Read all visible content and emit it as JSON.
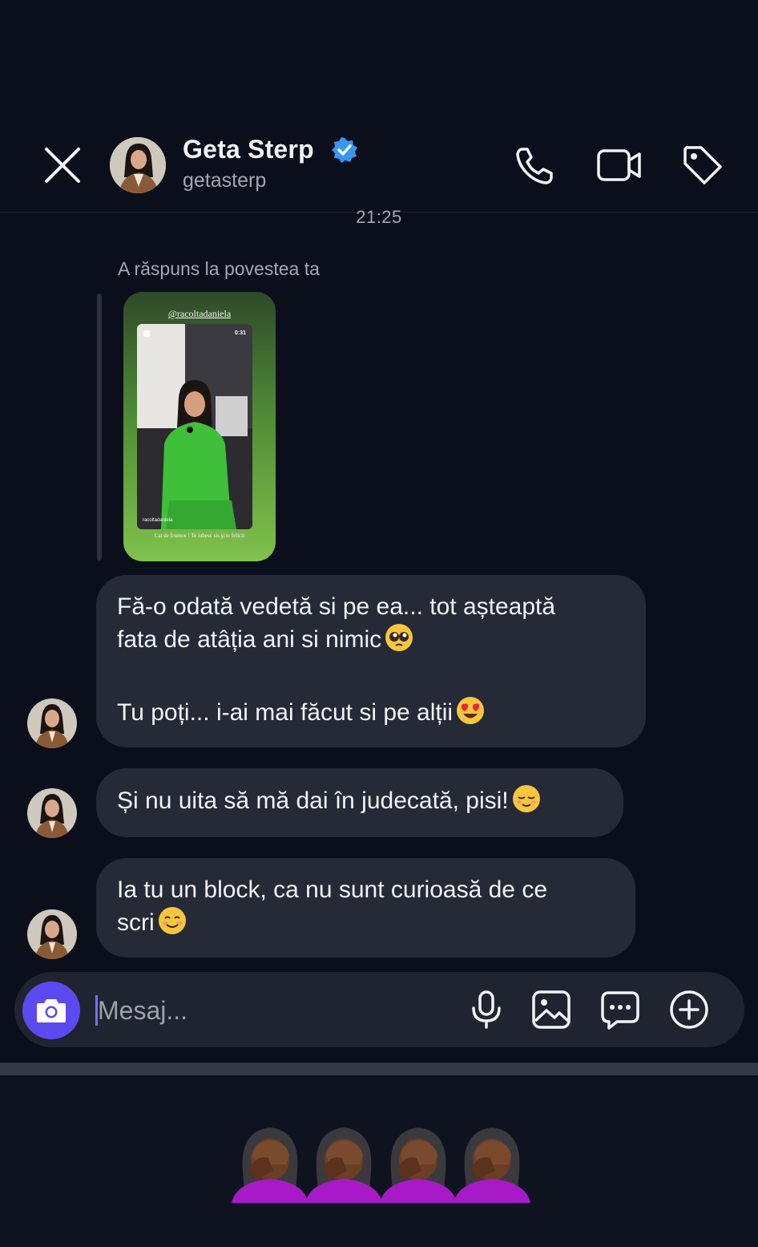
{
  "status": {
    "partial_text": ""
  },
  "header": {
    "name": "Geta Sterp",
    "handle": "getasterp",
    "verified_color": "#3897f0",
    "icons": [
      "close-icon",
      "phone-icon",
      "video-icon",
      "tag-icon"
    ]
  },
  "chat": {
    "timestamp": "21:25",
    "reply_note": "A răspuns la povestea ta",
    "story": {
      "handle": "@racoltadaniela",
      "duration": "0:31",
      "username": "racoltadaniela",
      "caption": "Cat de frumos ! Te iubesc sis și te felicit"
    },
    "messages": [
      {
        "lines": [
          "Fă-o odată vedetă si pe ea... tot așteaptă",
          "fata de atâția ani si nimic"
        ],
        "emoji": "pleading-face",
        "lines2": [
          "Tu poți... i-ai mai făcut si pe alții"
        ],
        "emoji2": "heart-eyes-face"
      },
      {
        "lines": [
          "Și nu uita să mă dai în judecată, pisi!"
        ],
        "emoji": "relieved-face"
      },
      {
        "lines": [
          "Ia tu un block, ca nu sunt curioasă de ce",
          "scri"
        ],
        "emoji": "smiling-face"
      }
    ]
  },
  "composer": {
    "placeholder": "Mesaj...",
    "icons": [
      "camera-icon",
      "microphone-icon",
      "gallery-icon",
      "sticker-icon",
      "add-icon"
    ]
  },
  "reaction_strip": {
    "emoji": "facepalm",
    "count": 4
  },
  "colors": {
    "background": "#0b0f1c",
    "bubble": "#252a36",
    "accent": "#5b4af0"
  }
}
